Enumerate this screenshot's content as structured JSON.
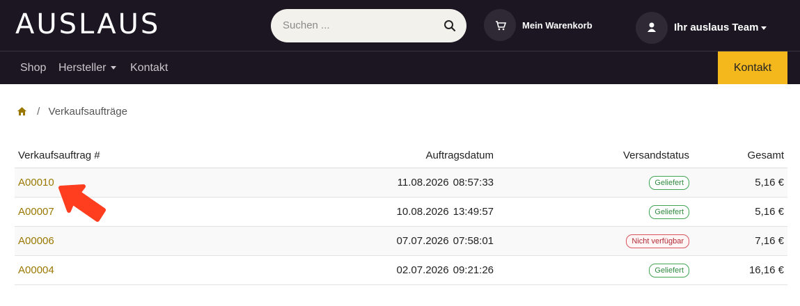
{
  "header": {
    "logo_text": "AUSLAUS",
    "search_placeholder": "Suchen ...",
    "cart_label": "Mein Warenkorb",
    "user_label": "Ihr auslaus Team"
  },
  "nav": {
    "items": [
      "Shop",
      "Hersteller",
      "Kontakt"
    ],
    "cta_label": "Kontakt"
  },
  "breadcrumb": {
    "current": "Verkaufsaufträge"
  },
  "table": {
    "headers": [
      "Verkaufsauftrag #",
      "Auftragsdatum",
      "Versandstatus",
      "Gesamt"
    ],
    "rows": [
      {
        "id": "A00010",
        "date": "11.08.2026",
        "time": "08:57:33",
        "status": "Geliefert",
        "total": "5,16 €"
      },
      {
        "id": "A00007",
        "date": "10.08.2026",
        "time": "13:49:57",
        "status": "Geliefert",
        "total": "5,16 €"
      },
      {
        "id": "A00006",
        "date": "07.07.2026",
        "time": "07:58:01",
        "status": "Nicht verfügbar",
        "total": "7,16 €"
      },
      {
        "id": "A00004",
        "date": "02.07.2026",
        "time": "09:21:26",
        "status": "Geliefert",
        "total": "16,16 €"
      }
    ]
  },
  "colors": {
    "header_bg": "#1c1622",
    "accent": "#f5b81c",
    "link": "#9a7800",
    "status_ok": "#2f8a3f",
    "status_unavailable": "#b02a37",
    "arrow": "#ff3d1f"
  },
  "icons": {
    "search": "search-icon",
    "cart": "cart-icon",
    "user": "user-icon",
    "home": "home-icon",
    "annotation": "arrow-annotation"
  }
}
